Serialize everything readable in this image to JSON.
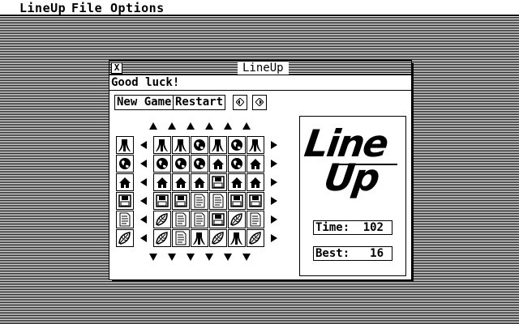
{
  "menubar": {
    "items": [
      "LineUp",
      "File",
      "Options"
    ]
  },
  "window": {
    "title": "LineUp",
    "close_glyph": "X",
    "status": "Good luck!",
    "buttons": {
      "new_game": "New Game",
      "restart": "Restart"
    }
  },
  "board": {
    "icons": {
      "A": "atari-logo-icon",
      "G": "globe-icon",
      "H": "house-icon",
      "F": "floppy-disk-icon",
      "D": "document-icon",
      "L": "leaf-icon"
    },
    "rows": [
      [
        "A",
        "A",
        "A",
        "G",
        "A",
        "G",
        "A"
      ],
      [
        "G",
        "G",
        "G",
        "G",
        "H",
        "G",
        "H"
      ],
      [
        "H",
        "H",
        "H",
        "H",
        "F",
        "H",
        "H"
      ],
      [
        "F",
        "F",
        "F",
        "D",
        "D",
        "F",
        "F"
      ],
      [
        "D",
        "L",
        "D",
        "D",
        "F",
        "L",
        "D"
      ],
      [
        "L",
        "L",
        "D",
        "A",
        "L",
        "A",
        "L"
      ]
    ]
  },
  "panel": {
    "logo_line1": "Line",
    "logo_line2": "Up",
    "time_label": "Time:",
    "time_value": "102",
    "best_label": "Best:",
    "best_value": "16"
  }
}
